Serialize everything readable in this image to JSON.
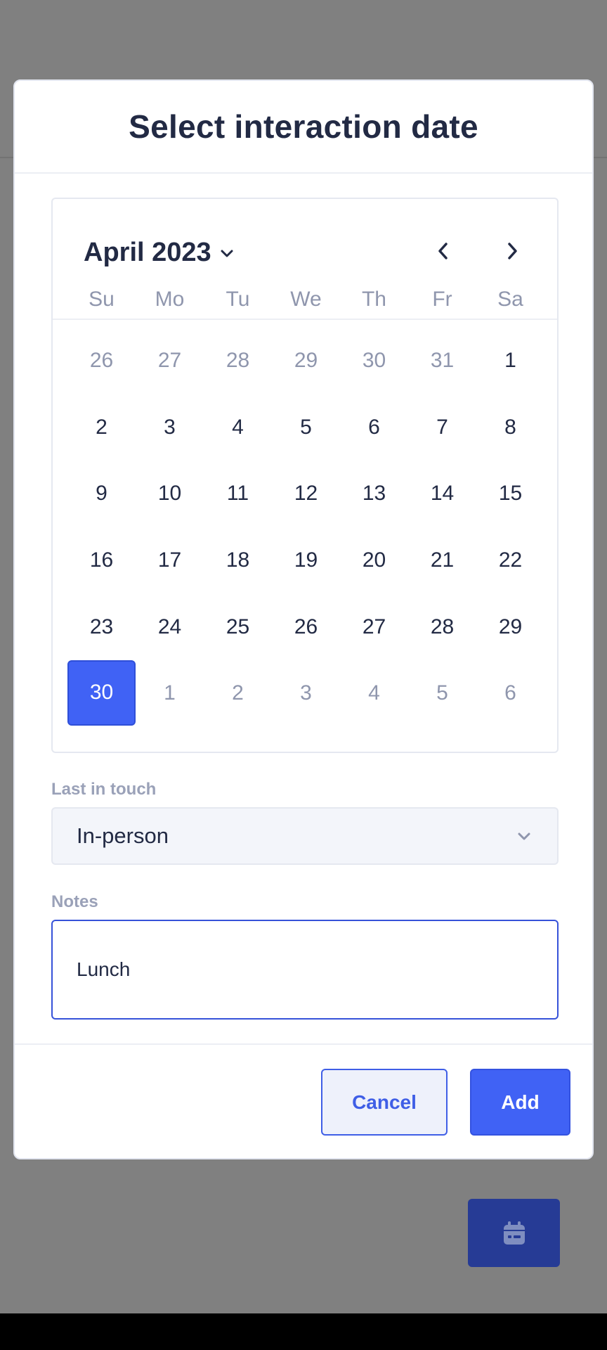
{
  "modal": {
    "title": "Select interaction date"
  },
  "calendar": {
    "month_label": "April 2023",
    "weekdays": [
      "Su",
      "Mo",
      "Tu",
      "We",
      "Th",
      "Fr",
      "Sa"
    ],
    "selected_day": "30",
    "days": [
      {
        "label": "26",
        "muted": true
      },
      {
        "label": "27",
        "muted": true
      },
      {
        "label": "28",
        "muted": true
      },
      {
        "label": "29",
        "muted": true
      },
      {
        "label": "30",
        "muted": true
      },
      {
        "label": "31",
        "muted": true
      },
      {
        "label": "1",
        "muted": false
      },
      {
        "label": "2",
        "muted": false
      },
      {
        "label": "3",
        "muted": false
      },
      {
        "label": "4",
        "muted": false
      },
      {
        "label": "5",
        "muted": false
      },
      {
        "label": "6",
        "muted": false
      },
      {
        "label": "7",
        "muted": false
      },
      {
        "label": "8",
        "muted": false
      },
      {
        "label": "9",
        "muted": false
      },
      {
        "label": "10",
        "muted": false
      },
      {
        "label": "11",
        "muted": false
      },
      {
        "label": "12",
        "muted": false
      },
      {
        "label": "13",
        "muted": false
      },
      {
        "label": "14",
        "muted": false
      },
      {
        "label": "15",
        "muted": false
      },
      {
        "label": "16",
        "muted": false
      },
      {
        "label": "17",
        "muted": false
      },
      {
        "label": "18",
        "muted": false
      },
      {
        "label": "19",
        "muted": false
      },
      {
        "label": "20",
        "muted": false
      },
      {
        "label": "21",
        "muted": false
      },
      {
        "label": "22",
        "muted": false
      },
      {
        "label": "23",
        "muted": false
      },
      {
        "label": "24",
        "muted": false
      },
      {
        "label": "25",
        "muted": false
      },
      {
        "label": "26",
        "muted": false
      },
      {
        "label": "27",
        "muted": false
      },
      {
        "label": "28",
        "muted": false
      },
      {
        "label": "29",
        "muted": false
      },
      {
        "label": "30",
        "muted": false,
        "selected": true
      },
      {
        "label": "1",
        "muted": true
      },
      {
        "label": "2",
        "muted": true
      },
      {
        "label": "3",
        "muted": true
      },
      {
        "label": "4",
        "muted": true
      },
      {
        "label": "5",
        "muted": true
      },
      {
        "label": "6",
        "muted": true
      }
    ]
  },
  "form": {
    "contact_label": "Last in touch",
    "contact_value": "In-person",
    "notes_label": "Notes",
    "notes_value": "Lunch"
  },
  "footer": {
    "cancel_label": "Cancel",
    "add_label": "Add"
  },
  "icons": {
    "month_dropdown": "chevron-down-icon",
    "prev": "chevron-left-icon",
    "next": "chevron-right-icon",
    "select": "chevron-down-icon",
    "fab": "calendar-icon"
  },
  "colors": {
    "accent": "#4062f5",
    "overlay": "#808080",
    "fab": "#263b95",
    "text": "#222a44",
    "muted": "#8f96ad"
  }
}
